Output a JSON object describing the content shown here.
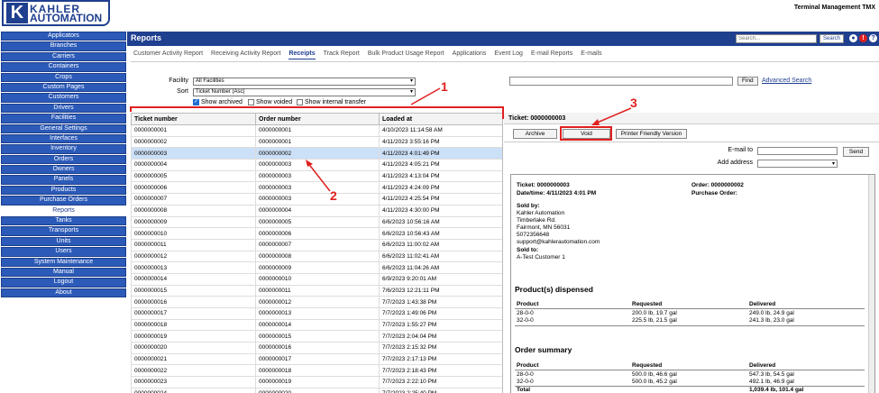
{
  "brand": {
    "logo_letter": "K",
    "logo_line1": "KAHLER",
    "logo_line2": "AUTOMATION"
  },
  "app_title": "Terminal Management TMX",
  "sidebar": {
    "items": [
      {
        "label": "Applicators"
      },
      {
        "label": "Branches"
      },
      {
        "label": "Carriers"
      },
      {
        "label": "Containers"
      },
      {
        "label": "Crops"
      },
      {
        "label": "Custom Pages"
      },
      {
        "label": "Customers"
      },
      {
        "label": "Drivers"
      },
      {
        "label": "Facilities"
      },
      {
        "label": "General Settings"
      },
      {
        "label": "Interfaces"
      },
      {
        "label": "Inventory"
      },
      {
        "label": "Orders"
      },
      {
        "label": "Owners"
      },
      {
        "label": "Panels"
      },
      {
        "label": "Products"
      },
      {
        "label": "Purchase Orders"
      },
      {
        "label": "Reports"
      },
      {
        "label": "Tanks"
      },
      {
        "label": "Transports"
      },
      {
        "label": "Units"
      },
      {
        "label": "Users"
      },
      {
        "label": "System Maintenance"
      },
      {
        "label": "Manual"
      },
      {
        "label": "Logout"
      },
      {
        "label": "About"
      }
    ],
    "active_index": 17
  },
  "topbar": {
    "title": "Reports",
    "search_placeholder": "Search...",
    "search_button": "Search",
    "icons": [
      "user-icon",
      "logout-icon",
      "help-icon"
    ],
    "icon_glyphs": [
      "●",
      "!",
      "?"
    ]
  },
  "tabs": [
    {
      "label": "Customer Activity Report"
    },
    {
      "label": "Receiving Activity Report"
    },
    {
      "label": "Receipts"
    },
    {
      "label": "Track Report"
    },
    {
      "label": "Bulk Product Usage Report"
    },
    {
      "label": "Applications"
    },
    {
      "label": "Event Log"
    },
    {
      "label": "E-mail Reports"
    },
    {
      "label": "E-mails"
    }
  ],
  "active_tab": 2,
  "filters": {
    "facility_label": "Facility",
    "facility_value": "All Facilities",
    "sort_label": "Sort",
    "sort_value": "Ticket Number (Asc)",
    "show_archived": "Show archived",
    "show_voided": "Show voided",
    "show_internal": "Show internal transfer"
  },
  "table": {
    "columns": [
      "Ticket number",
      "Order number",
      "Loaded at"
    ],
    "rows": [
      [
        "0000000001",
        "0000000001",
        "4/10/2023 11:14:58 AM"
      ],
      [
        "0000000002",
        "0000000001",
        "4/11/2023 3:55:16 PM"
      ],
      [
        "0000000003",
        "0000000002",
        "4/11/2023 4:01:49 PM"
      ],
      [
        "0000000004",
        "0000000003",
        "4/11/2023 4:05:21 PM"
      ],
      [
        "0000000005",
        "0000000003",
        "4/11/2023 4:13:04 PM"
      ],
      [
        "0000000006",
        "0000000003",
        "4/11/2023 4:24:09 PM"
      ],
      [
        "0000000007",
        "0000000003",
        "4/11/2023 4:25:54 PM"
      ],
      [
        "0000000008",
        "0000000004",
        "4/11/2023 4:30:00 PM"
      ],
      [
        "0000000009",
        "0000000005",
        "6/6/2023 10:56:16 AM"
      ],
      [
        "0000000010",
        "0000000006",
        "6/6/2023 10:56:43 AM"
      ],
      [
        "0000000011",
        "0000000007",
        "6/6/2023 11:00:02 AM"
      ],
      [
        "0000000012",
        "0000000008",
        "6/6/2023 11:02:41 AM"
      ],
      [
        "0000000013",
        "0000000009",
        "6/6/2023 11:04:26 AM"
      ],
      [
        "0000000014",
        "0000000010",
        "6/9/2023 9:20:01 AM"
      ],
      [
        "0000000015",
        "0000000011",
        "7/6/2023 12:21:11 PM"
      ],
      [
        "0000000016",
        "0000000012",
        "7/7/2023 1:43:38 PM"
      ],
      [
        "0000000017",
        "0000000013",
        "7/7/2023 1:49:06 PM"
      ],
      [
        "0000000018",
        "0000000014",
        "7/7/2023 1:55:27 PM"
      ],
      [
        "0000000019",
        "0000000015",
        "7/7/2023 2:04:04 PM"
      ],
      [
        "0000000020",
        "0000000016",
        "7/7/2023 2:15:32 PM"
      ],
      [
        "0000000021",
        "0000000017",
        "7/7/2023 2:17:13 PM"
      ],
      [
        "0000000022",
        "0000000018",
        "7/7/2023 2:18:43 PM"
      ],
      [
        "0000000023",
        "0000000019",
        "7/7/2023 2:22:10 PM"
      ],
      [
        "0000000024",
        "0000000020",
        "7/7/2023 2:25:40 PM"
      ]
    ],
    "selected_index": 2
  },
  "detail": {
    "find_button": "Find",
    "advanced_search": "Advanced Search",
    "ticket_header": "Ticket: 0000000003",
    "archive_button": "Archive",
    "void_button": "Void",
    "printer_button": "Printer Friendly Version",
    "email_label": "E-mail to",
    "send_button": "Send",
    "address_label": "Add address"
  },
  "receipt": {
    "ticket": "Ticket: 0000000003",
    "datetime": "Date/time: 4/11/2023 4:01 PM",
    "order": "Order: 0000000002",
    "purchase_order": "Purchase Order:",
    "sold_by_label": "Sold by:",
    "sold_by_lines": [
      "Kahler Automation",
      "Timberlake Rd.",
      "Fairmont, MN 56031",
      "5072356648",
      "support@kahlerautomation.com"
    ],
    "sold_to_label": "Sold to:",
    "sold_to": "A-Test Customer 1",
    "dispensed_title": "Product(s) dispensed",
    "col_product": "Product",
    "col_requested": "Requested",
    "col_delivered": "Delivered",
    "dispensed_rows": [
      [
        "28-0-0",
        "200.0 lb, 19.7 gal",
        "249.0 lb, 24.9 gal"
      ],
      [
        "32-0-0",
        "225.5 lb, 21.5 gal",
        "241.3 lb, 23.0 gal"
      ]
    ],
    "summary_title": "Order summary",
    "summary_rows": [
      [
        "28-0-0",
        "500.0 lb, 46.6 gal",
        "547.3 lb, 54.5 gal"
      ],
      [
        "32-0-0",
        "500.0 lb, 45.2 gal",
        "492.1 lb, 46.9 gal"
      ]
    ],
    "total_label": "Total",
    "total_value": "1,039.4 lb, 101.4 gal"
  },
  "annotations": {
    "one": "1",
    "two": "2",
    "three": "3",
    "color": "#e02020"
  },
  "colors": {
    "brand_blue": "#1f3f8f",
    "sidebar_blue": "#2b5ab8",
    "selected_row": "#cce0f7"
  }
}
